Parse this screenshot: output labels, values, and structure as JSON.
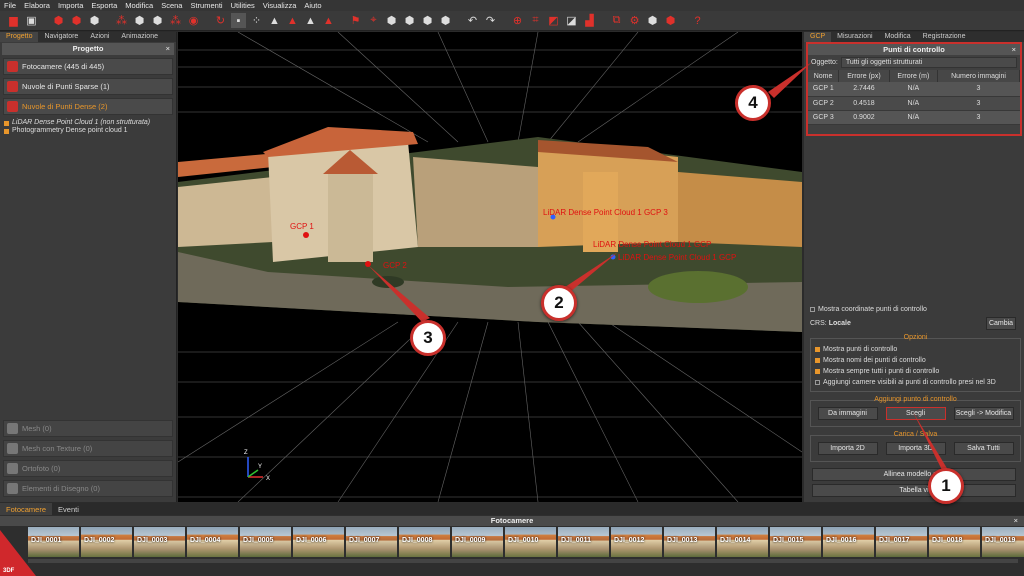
{
  "menu": [
    "File",
    "Elabora",
    "Importa",
    "Esporta",
    "Modifica",
    "Scena",
    "Strumenti",
    "Utilities",
    "Visualizza",
    "Aiuto"
  ],
  "left": {
    "tabs": [
      "Progetto",
      "Navigatore",
      "Azioni",
      "Animazione"
    ],
    "panel_title": "Progetto",
    "items": {
      "cameras": "Fotocamere (445 di 445)",
      "sparse": "Nuvole di Punti Sparse (1)",
      "dense": "Nuvole di Punti Dense (2)"
    },
    "tree": [
      "LiDAR Dense Point Cloud 1 (non strutturata)",
      "Photogrammetry Dense point cloud 1"
    ],
    "bottom_items": [
      "Mesh (0)",
      "Mesh con Texture (0)",
      "Ortofoto (0)",
      "Elementi di Disegno (0)"
    ]
  },
  "viewport": {
    "labels": [
      "GCP 1",
      "GCP 2",
      "LiDAR Dense Point Cloud 1 GCP 3",
      "LiDAR Dense Point Cloud 1 GCP",
      "LiDAR Dense Point Cloud 1 GCP"
    ],
    "axes": [
      "Z",
      "Y",
      "X"
    ]
  },
  "right": {
    "tabs": [
      "GCP",
      "Misurazioni",
      "Modifica",
      "Registrazione"
    ],
    "title": "Punti di controllo",
    "oggetto_label": "Oggetto:",
    "oggetto_value": "Tutti gli oggetti strutturati",
    "columns": [
      "Nome",
      "Errore (px)",
      "Errore (m)",
      "Numero immagini"
    ],
    "rows": [
      [
        "GCP 1",
        "2.7446",
        "N/A",
        "3"
      ],
      [
        "GCP 2",
        "0.4518",
        "N/A",
        "3"
      ],
      [
        "GCP 3",
        "0.9002",
        "N/A",
        "3"
      ]
    ],
    "mostra_coord": "Mostra coordinate punti di controllo",
    "crs_label": "CRS:",
    "crs_value": "Locale",
    "cambia": "Cambia",
    "opzioni_title": "Opzioni",
    "options": [
      {
        "label": "Mostra punti di controllo",
        "checked": true
      },
      {
        "label": "Mostra nomi dei punti di controllo",
        "checked": true
      },
      {
        "label": "Mostra sempre tutti i punti di controllo",
        "checked": true
      },
      {
        "label": "Aggiungi camere visibili ai punti di controllo presi nel 3D",
        "checked": false
      }
    ],
    "aggiungi_title": "Aggiungi punto di controllo",
    "aggiungi_buttons": [
      "Da immagini",
      "Scegli",
      "Scegli -> Modifica"
    ],
    "carica_title": "Carica / Salva",
    "carica_buttons": [
      "Importa 2D",
      "Importa 3D",
      "Salva Tutti"
    ],
    "allinea": "Allinea modello con",
    "tabella": "Tabella vi"
  },
  "bottom": {
    "tabs": [
      "Fotocamere",
      "Eventi"
    ],
    "title": "Fotocamere",
    "thumbs": [
      "DJI_0001",
      "DJI_0002",
      "DJI_0003",
      "DJI_0004",
      "DJI_0005",
      "DJI_0006",
      "DJI_0007",
      "DJI_0008",
      "DJI_0009",
      "DJI_0010",
      "DJI_0011",
      "DJI_0012",
      "DJI_0013",
      "DJI_0014",
      "DJI_0015",
      "DJI_0016",
      "DJI_0017",
      "DJI_0018",
      "DJI_0019"
    ]
  },
  "callouts": [
    "1",
    "2",
    "3",
    "4"
  ],
  "logo_text": "3DF",
  "colors": {
    "accent": "#e8962b",
    "highlight": "#c9302c"
  }
}
